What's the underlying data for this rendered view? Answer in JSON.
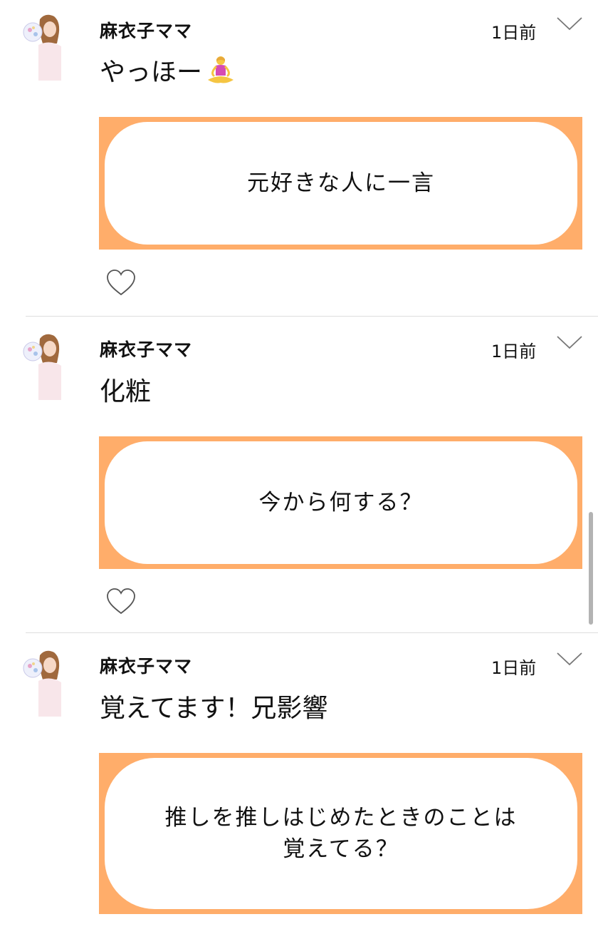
{
  "posts": [
    {
      "username": "麻衣子ママ",
      "time": "1日前",
      "text": "やっほー",
      "emoji_icon": "meditating-woman-icon",
      "topic_lines": [
        "元好きな人に一言"
      ]
    },
    {
      "username": "麻衣子ママ",
      "time": "1日前",
      "text": "化粧",
      "topic_lines": [
        "今から何する？"
      ]
    },
    {
      "username": "麻衣子ママ",
      "time": "1日前",
      "text": "覚えてます！兄影響",
      "topic_lines": [
        "推しを推しはじめたときのことは",
        "覚えてる？"
      ]
    }
  ],
  "colors": {
    "topic_border": "#ffad6a",
    "divider": "#dedede",
    "text": "#111111",
    "icon_stroke": "#555555"
  },
  "icons": {
    "menu": "chevron-down-icon",
    "like": "heart-outline-icon",
    "avatar": "user-avatar"
  }
}
